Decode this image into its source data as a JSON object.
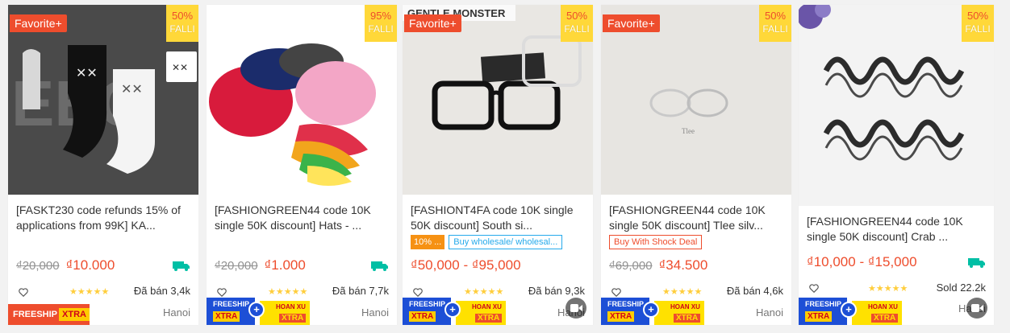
{
  "colors": {
    "accent": "#ee4d2d",
    "star": "#ffce3d",
    "badge_yellow": "#ffd839"
  },
  "products": [
    {
      "favorite": "Favorite+",
      "discount": "50%",
      "discount_label": "FALLI",
      "freeship": "FREESHIP",
      "freeship_xtra": "XTRA",
      "title": "[FASKT230 code refunds 15% of applications from 99K] KA...",
      "old_price": "₫20,000",
      "price": "₫10.000",
      "rating": "★★★★★",
      "sold": "Đã bán 3,4k",
      "location": "Hanoi"
    },
    {
      "discount": "95%",
      "discount_label": "FALLI",
      "freeship": "FREESHIP",
      "freeship_xtra": "XTRA",
      "hoan_xu": "HOAN XU",
      "hoan_xu_xtra": "XTRA",
      "title": "[FASHIONGREEN44 code 10K single 50K discount] Hats - ...",
      "old_price": "₫20,000",
      "price": "₫1.000",
      "rating": "★★★★★",
      "sold": "Đã bán 7,7k",
      "location": "Hanoi"
    },
    {
      "favorite": "Favorite+",
      "discount": "50%",
      "discount_label": "FALLI",
      "freeship": "FREESHIP",
      "freeship_xtra": "XTRA",
      "hoan_xu": "HOAN XU",
      "hoan_xu_xtra": "XTRA",
      "photo_text": "GENTLE MONSTER",
      "title": "[FASHIONT4FA code 10K single 50K discount] South si...",
      "tag_discount": "10% ...",
      "tag_wholesale": "Buy wholesale/ wholesal...",
      "price": "₫50,000 - ₫95,000",
      "rating": "★★★★★",
      "sold": "Đã bán 9,3k",
      "location": "Hanoi"
    },
    {
      "favorite": "Favorite+",
      "discount": "50%",
      "discount_label": "FALLI",
      "freeship": "FREESHIP",
      "freeship_xtra": "XTRA",
      "hoan_xu": "HOAN XU",
      "hoan_xu_xtra": "XTRA",
      "title": "[FASHIONGREEN44 code 10K single 50K discount] Tlee silv...",
      "tag_deal": "Buy With Shock Deal",
      "old_price": "₫69,000",
      "price": "₫34.500",
      "rating": "★★★★★",
      "sold": "Đã bán 4,6k",
      "location": "Hanoi"
    },
    {
      "discount": "50%",
      "discount_label": "FALLI",
      "freeship": "FREESHIP",
      "freeship_xtra": "XTRA",
      "hoan_xu": "HOAN XU",
      "hoan_xu_xtra": "XTRA",
      "title": "[FASHIONGREEN44 code 10K single 50K discount] Crab ...",
      "price": "₫10,000 - ₫15,000",
      "rating": "★★★★★",
      "sold": "Sold 22.2k",
      "location": "Hanoi"
    }
  ]
}
